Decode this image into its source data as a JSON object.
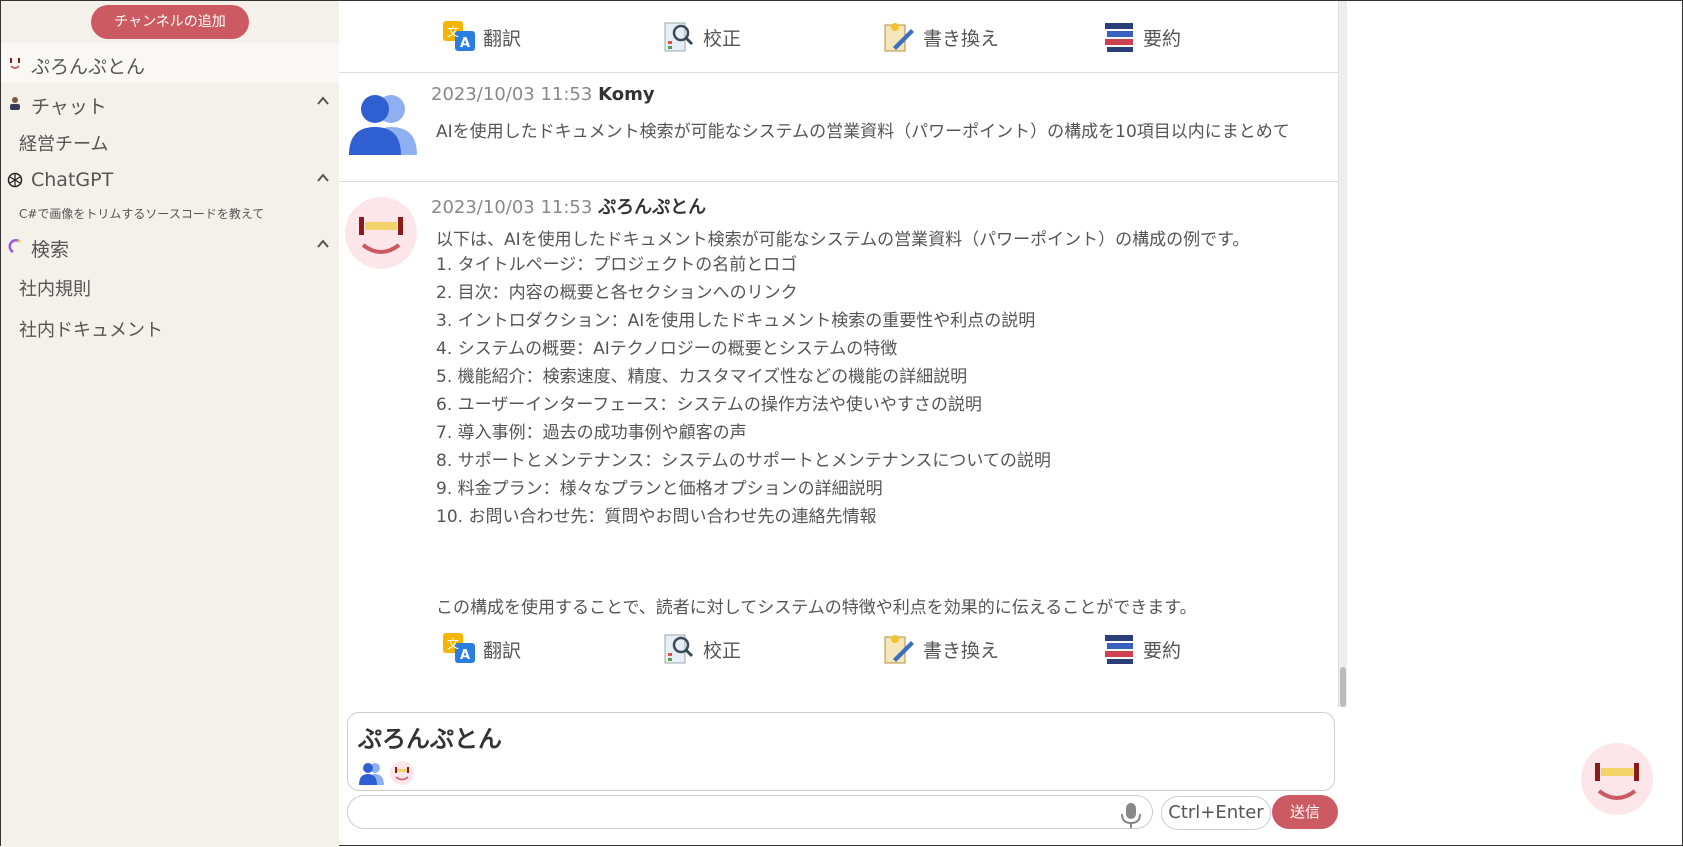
{
  "sidebar": {
    "add_channel_label": "チャンネルの追加",
    "items": [
      {
        "label": "ぷろんぷとん"
      },
      {
        "label": "チャット"
      },
      {
        "label": "経営チーム"
      },
      {
        "label": "ChatGPT"
      },
      {
        "label": "C#で画像をトリムするソースコードを教えて"
      },
      {
        "label": "検索"
      },
      {
        "label": "社内規則"
      },
      {
        "label": "社内ドキュメント"
      }
    ]
  },
  "toolbar": {
    "translate": "翻訳",
    "proofread": "校正",
    "rewrite": "書き換え",
    "summarize": "要約"
  },
  "messages": [
    {
      "timestamp": "2023/10/03 11:53",
      "author": "Komy",
      "text": "AIを使用したドキュメント検索が可能なシステムの営業資料（パワーポイント）の構成を10項目以内にまとめて"
    },
    {
      "timestamp": "2023/10/03 11:53",
      "author": "ぷろんぷとん",
      "intro": "以下は、AIを使用したドキュメント検索が可能なシステムの営業資料（パワーポイント）の構成の例です。",
      "items": [
        "1. タイトルページ：プロジェクトの名前とロゴ",
        "2. 目次：内容の概要と各セクションへのリンク",
        "3. イントロダクション：AIを使用したドキュメント検索の重要性や利点の説明",
        "4. システムの概要：AIテクノロジーの概要とシステムの特徴",
        "5. 機能紹介：検索速度、精度、カスタマイズ性などの機能の詳細説明",
        "6. ユーザーインターフェース：システムの操作方法や使いやすさの説明",
        "7. 導入事例：過去の成功事例や顧客の声",
        "8. サポートとメンテナンス：システムのサポートとメンテナンスについての説明",
        "9. 料金プラン：様々なプランと価格オプションの詳細説明",
        "10. お問い合わせ先：質問やお問い合わせ先の連絡先情報"
      ],
      "outro": "この構成を使用することで、読者に対してシステムの特徴や利点を効果的に伝えることができます。"
    }
  ],
  "compose": {
    "channel_title": "ぷろんぷとん",
    "shortcut_label": "Ctrl+Enter",
    "send_label": "送信"
  },
  "colors": {
    "accent": "#cc5a62",
    "sidebar_bg": "#f4f1eb"
  }
}
